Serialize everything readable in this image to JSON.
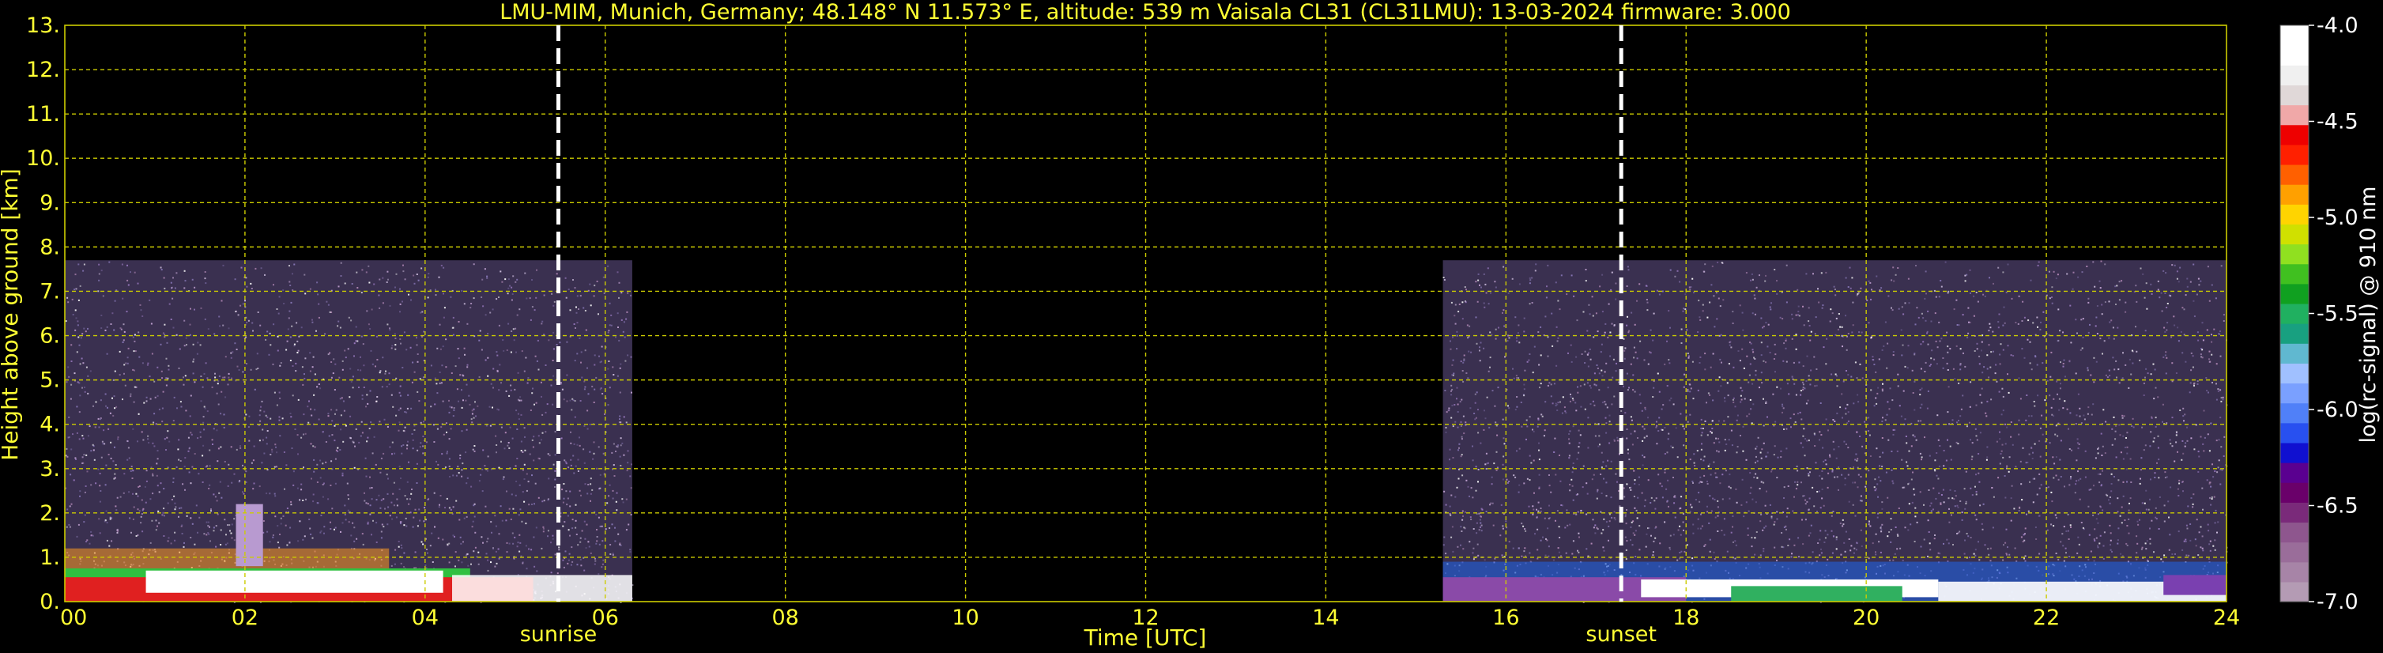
{
  "title": "LMU-MIM, Munich, Germany; 48.148° N 11.573° E, altitude: 539 m    Vaisala CL31 (CL31LMU): 13-03-2024    firmware: 3.000",
  "chart_data": {
    "type": "heatmap",
    "xlabel": "Time [UTC]",
    "ylabel": "Height above ground [km]",
    "xlim": [
      0,
      24
    ],
    "ylim": [
      0,
      13
    ],
    "x_ticks": [
      "00",
      "02",
      "04",
      "06",
      "08",
      "10",
      "12",
      "14",
      "16",
      "18",
      "20",
      "22",
      "24"
    ],
    "y_ticks": [
      "0.",
      "1.",
      "2.",
      "3.",
      "4.",
      "5.",
      "6.",
      "7.",
      "8.",
      "9.",
      "10.",
      "11.",
      "12.",
      "13."
    ],
    "grid": true,
    "data_coverage": [
      {
        "start_hour": 0.0,
        "end_hour": 6.3,
        "max_height_km": 7.7
      },
      {
        "start_hour": 15.3,
        "end_hour": 24.0,
        "max_height_km": 7.7
      }
    ],
    "events": [
      {
        "label": "sunrise",
        "hour": 5.48
      },
      {
        "label": "sunset",
        "hour": 17.28
      }
    ],
    "colorbar": {
      "label": "log(rc-signal) @ 910 nm",
      "range": [
        -7.0,
        -4.0
      ],
      "ticks": [
        "-4.0",
        "-4.5",
        "-5.0",
        "-5.5",
        "-6.0",
        "-6.5",
        "-7.0"
      ],
      "colors": [
        "#b49bb4",
        "#a784a7",
        "#9a6d9a",
        "#8e568e",
        "#7a2a7a",
        "#6a006a",
        "#5a0090",
        "#1010d0",
        "#2850f0",
        "#5080f8",
        "#7aa0ff",
        "#a0c0ff",
        "#60b8d0",
        "#18a080",
        "#20b060",
        "#10a020",
        "#40c020",
        "#90e020",
        "#d0e000",
        "#ffd400",
        "#ffa000",
        "#ff6000",
        "#ff2000",
        "#ee0000",
        "#f0a8a8",
        "#e0d8d8",
        "#f0f0f0",
        "#ffffff",
        "#ffffff"
      ]
    }
  }
}
